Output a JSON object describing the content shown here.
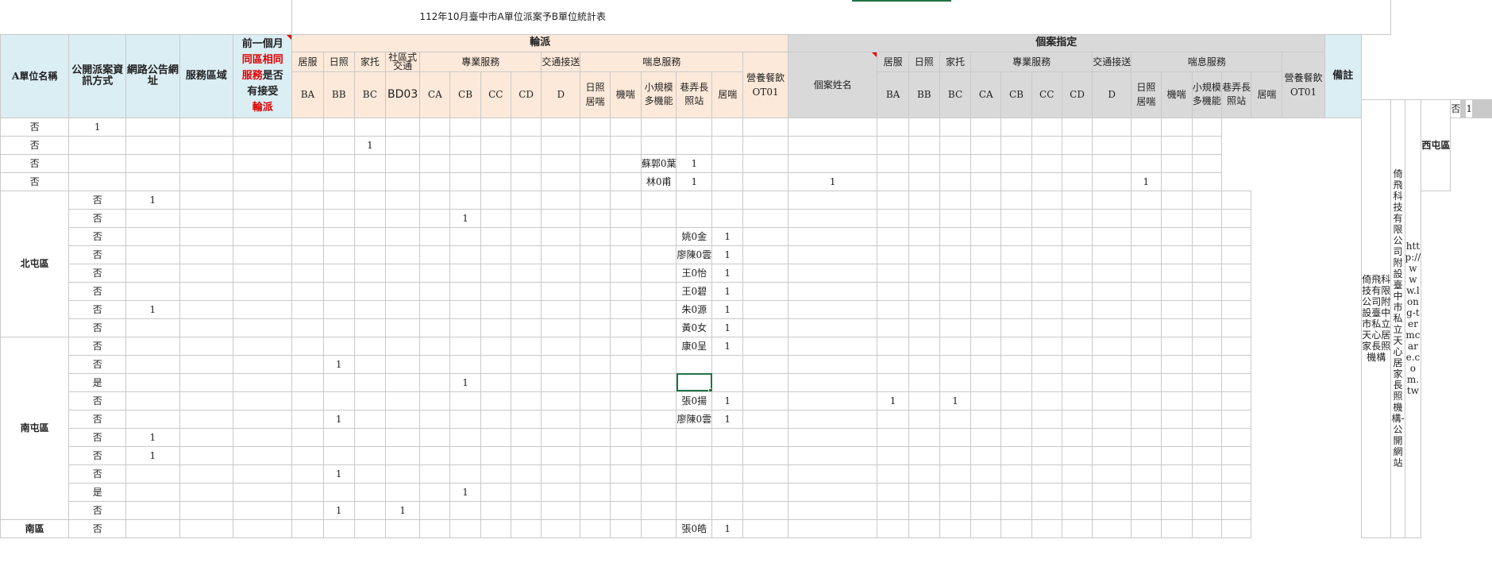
{
  "sheet": {
    "title": "112年10月臺中市A單位派案予B單位統計表",
    "headers": {
      "unit_name": "A單位名稱",
      "info_method": "公開派案資訊方式",
      "web_url": "網路公告網址",
      "service_area": "服務區域",
      "prev_month_q": [
        "前一個月",
        "同區相同",
        "服務",
        "是否",
        "有接受",
        "輪派"
      ],
      "rotation": "輪派",
      "case_assigned": "個案指定",
      "case_name": "個案姓名",
      "remark": "備註",
      "home_service": "居服",
      "day_care": "日照",
      "family_care": "家托",
      "community_transport": "社區式交通",
      "professional_service": "專業服務",
      "transport": "交通接送",
      "respite_service": "喘息服務",
      "nutrition_meal": "營養餐飲",
      "day_respite": "日照喘息",
      "institution_respite": "機喘",
      "small_multi": "小規模多機能",
      "alley_station": "巷弄長照站",
      "home_respite": "居喘",
      "codes_rot": [
        "BA",
        "BB",
        "BC",
        "BD03",
        "CA",
        "CB",
        "CC",
        "CD",
        "D"
      ],
      "codes_case": [
        "BA",
        "BB",
        "BC",
        "CA",
        "CB",
        "CC",
        "CD",
        "D"
      ],
      "ot01": "OT01",
      "nutrition_ot01": "營養餐飲OT01"
    },
    "unit": {
      "name": "倚飛科技有限公司附設臺中市私立天心居家長照機構",
      "info": "倚飛科技有限公司附設臺中市私立天心居家長照機構-公開網站",
      "url": "http://www.long-termcare.com.tw"
    },
    "regions": [
      {
        "name": "西屯區",
        "rows": 5
      },
      {
        "name": "北屯區",
        "rows": 8
      },
      {
        "name": "南屯區",
        "rows": 10
      },
      {
        "name": "南區",
        "rows": 1
      }
    ],
    "rows": [
      {
        "yn": "否",
        "rot": {
          "CC": "1"
        },
        "case": "",
        "cs": {}
      },
      {
        "yn": "否",
        "rot": {
          "BA": "1"
        },
        "case": "",
        "cs": {}
      },
      {
        "yn": "否",
        "rot": {
          "CC": "1"
        },
        "case": "",
        "cs": {}
      },
      {
        "yn": "否",
        "rot": {},
        "case": "蘇郭0葉",
        "cs": {
          "BA": "1"
        }
      },
      {
        "yn": "否",
        "rot": {},
        "case": "林0甫",
        "cs": {
          "BA": "1",
          "CA": "1",
          "HR": "1"
        }
      },
      {
        "yn": "否",
        "rot": {
          "BA": "1"
        },
        "case": "",
        "cs": {}
      },
      {
        "yn": "否",
        "rot": {
          "D": "1"
        },
        "case": "",
        "cs": {}
      },
      {
        "yn": "否",
        "rot": {},
        "case": "姚0金",
        "cs": {
          "BA": "1"
        }
      },
      {
        "yn": "否",
        "rot": {},
        "case": "廖陳0雲",
        "cs": {
          "BA": "1"
        }
      },
      {
        "yn": "否",
        "rot": {},
        "case": "王0怡",
        "cs": {
          "BA": "1"
        }
      },
      {
        "yn": "否",
        "rot": {},
        "case": "王0碧",
        "cs": {
          "BA": "1"
        }
      },
      {
        "yn": "否",
        "rot": {
          "BA": "1"
        },
        "case": "朱0源",
        "cs": {
          "BA": "1"
        }
      },
      {
        "yn": "否",
        "rot": {},
        "case": "黃0女",
        "cs": {
          "BA": "1"
        }
      },
      {
        "yn": "否",
        "rot": {},
        "case": "康0呈",
        "cs": {
          "BA": "1"
        }
      },
      {
        "yn": "否",
        "rot": {
          "CA": "1"
        },
        "case": "",
        "cs": {}
      },
      {
        "yn": "是",
        "rot": {
          "D": "1"
        },
        "case": "",
        "cs": {}
      },
      {
        "yn": "否",
        "rot": {},
        "case": "張0揚",
        "cs": {
          "BA": "1",
          "CA": "1",
          "CC": "1"
        }
      },
      {
        "yn": "否",
        "rot": {
          "CA": "1"
        },
        "case": "廖陳0雲",
        "cs": {
          "BA": "1"
        }
      },
      {
        "yn": "否",
        "rot": {
          "BA": "1"
        },
        "case": "",
        "cs": {}
      },
      {
        "yn": "否",
        "rot": {
          "BA": "1"
        },
        "case": "",
        "cs": {}
      },
      {
        "yn": "否",
        "rot": {
          "CA": "1"
        },
        "case": "",
        "cs": {}
      },
      {
        "yn": "是",
        "rot": {
          "D": "1"
        },
        "case": "",
        "cs": {}
      },
      {
        "yn": "否",
        "rot": {
          "CA": "1",
          "CC": "1"
        },
        "case": "",
        "cs": {}
      },
      {
        "yn": "否",
        "rot": {},
        "case": "張0皓",
        "cs": {
          "BA": "1"
        }
      }
    ]
  }
}
